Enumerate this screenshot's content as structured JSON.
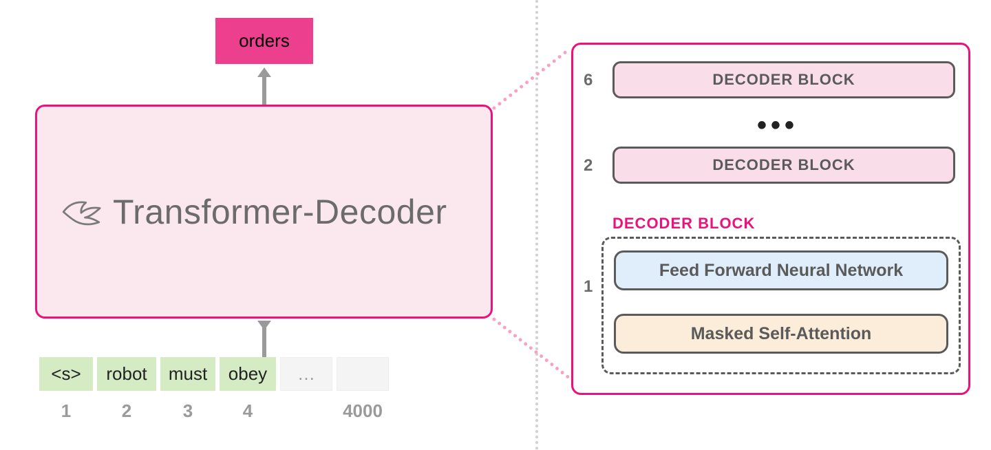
{
  "output_token": "orders",
  "transformer_label": "Transformer-Decoder",
  "tokens": [
    "<s>",
    "robot",
    "must",
    "obey",
    "…"
  ],
  "indices": [
    "1",
    "2",
    "3",
    "4",
    "4000"
  ],
  "right": {
    "layer_numbers": [
      "6",
      "2",
      "1"
    ],
    "decoder_block_label": "DECODER BLOCK",
    "ellipsis": "•••",
    "decoder_section_label": "DECODER BLOCK",
    "ffn_label": "Feed Forward Neural Network",
    "attention_label": "Masked Self-Attention"
  }
}
